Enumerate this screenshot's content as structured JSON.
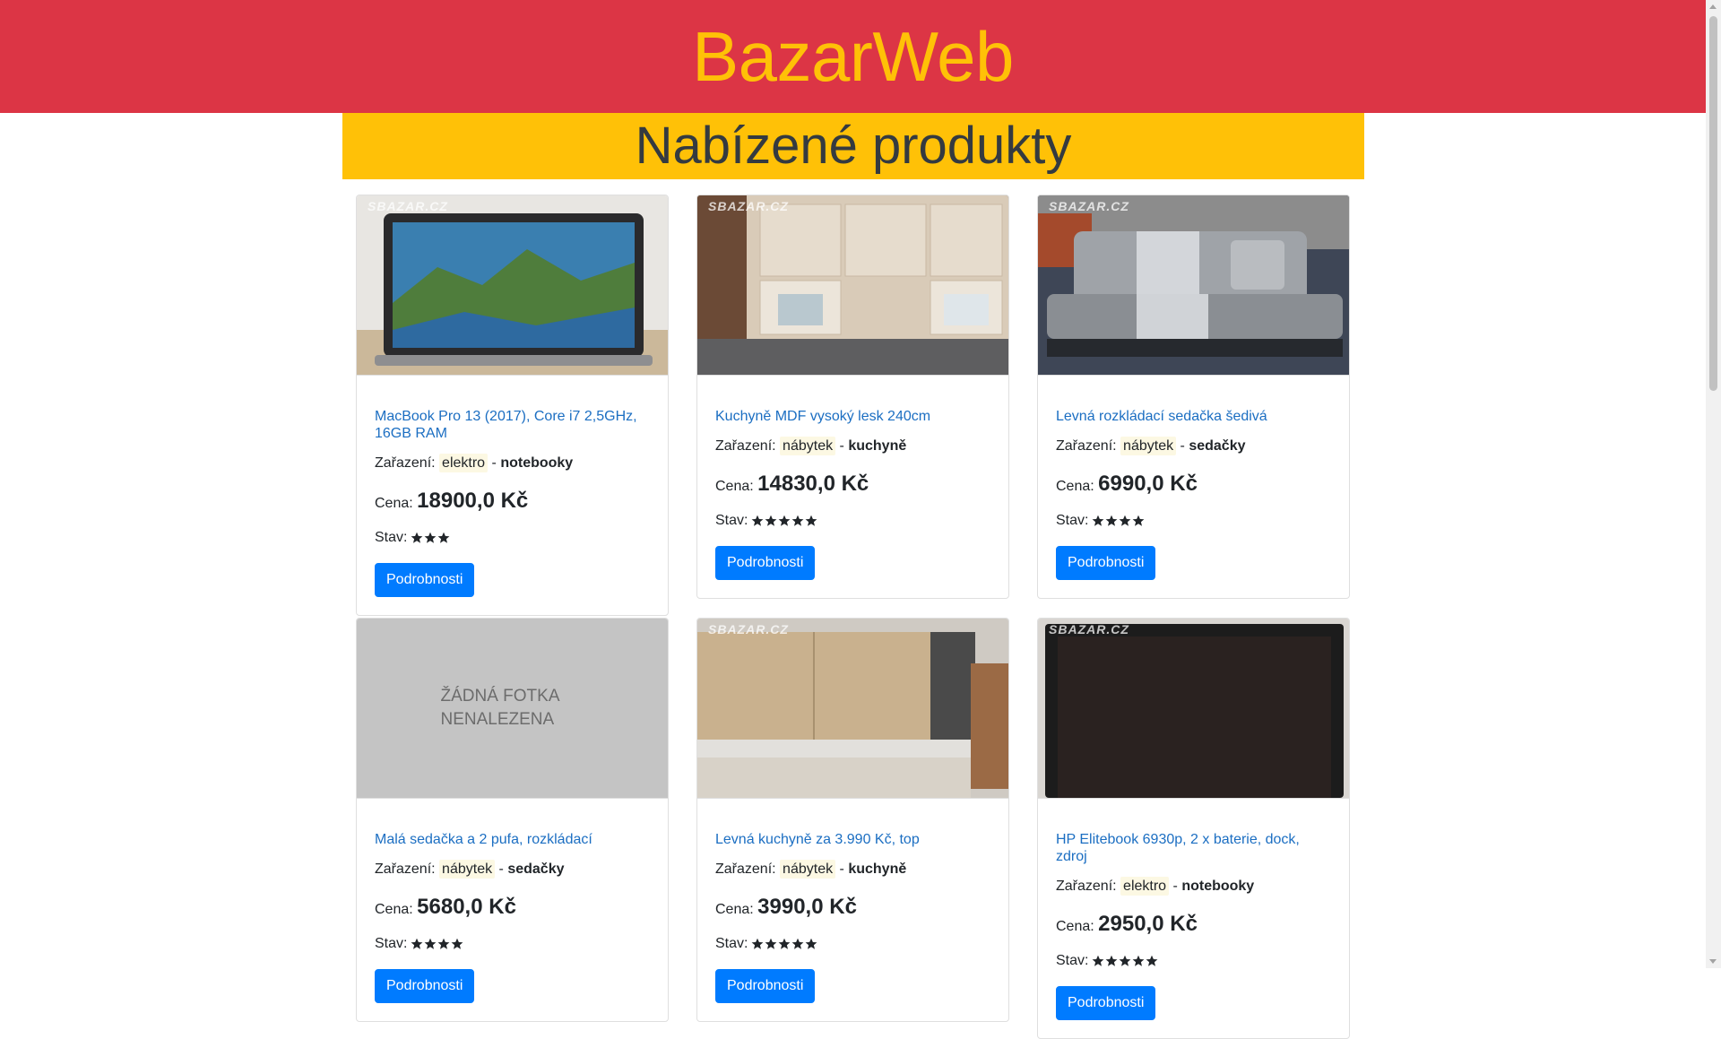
{
  "site": {
    "title": "BazarWeb"
  },
  "section": {
    "title": "Nabízené produkty"
  },
  "labels": {
    "category": "Zařazení:",
    "separator": "-",
    "price": "Cena:",
    "condition": "Stav:",
    "details_button": "Podrobnosti",
    "watermark": "SBAZAR.CZ"
  },
  "colors": {
    "header_bg": "#dc3545",
    "brand_text": "#ffc107",
    "band_bg": "#ffc107",
    "button": "#007bff",
    "link": "#1b6ec2"
  },
  "products": [
    {
      "title": "MacBook Pro 13 (2017), Core i7 2,5GHz, 16GB RAM",
      "category": "elektro",
      "subcategory": "notebooky",
      "price": "18900,0 Kč",
      "stars": 3,
      "image": "laptop-photo"
    },
    {
      "title": "Kuchyně MDF vysoký lesk 240cm",
      "category": "nábytek",
      "subcategory": "kuchyně",
      "price": "14830,0 Kč",
      "stars": 5,
      "image": "kitchen-photo"
    },
    {
      "title": "Levná rozkládací sedačka šedivá",
      "category": "nábytek",
      "subcategory": "sedačky",
      "price": "6990,0 Kč",
      "stars": 4,
      "image": "sofa-photo"
    },
    {
      "title": "Malá sedačka a 2 pufa, rozkládací",
      "category": "nábytek",
      "subcategory": "sedačky",
      "price": "5680,0 Kč",
      "stars": 4,
      "image": "no-photo",
      "no_photo_text": "ŽÁDNÁ FOTKA NENALEZENA"
    },
    {
      "title": "Levná kuchyně za 3.990 Kč, top",
      "category": "nábytek",
      "subcategory": "kuchyně",
      "price": "3990,0 Kč",
      "stars": 5,
      "image": "kitchen-cabinet-photo"
    },
    {
      "title": "HP Elitebook 6930p, 2 x baterie, dock, zdroj",
      "category": "elektro",
      "subcategory": "notebooky",
      "price": "2950,0 Kč",
      "stars": 5,
      "image": "laptop-screen-photo"
    }
  ]
}
